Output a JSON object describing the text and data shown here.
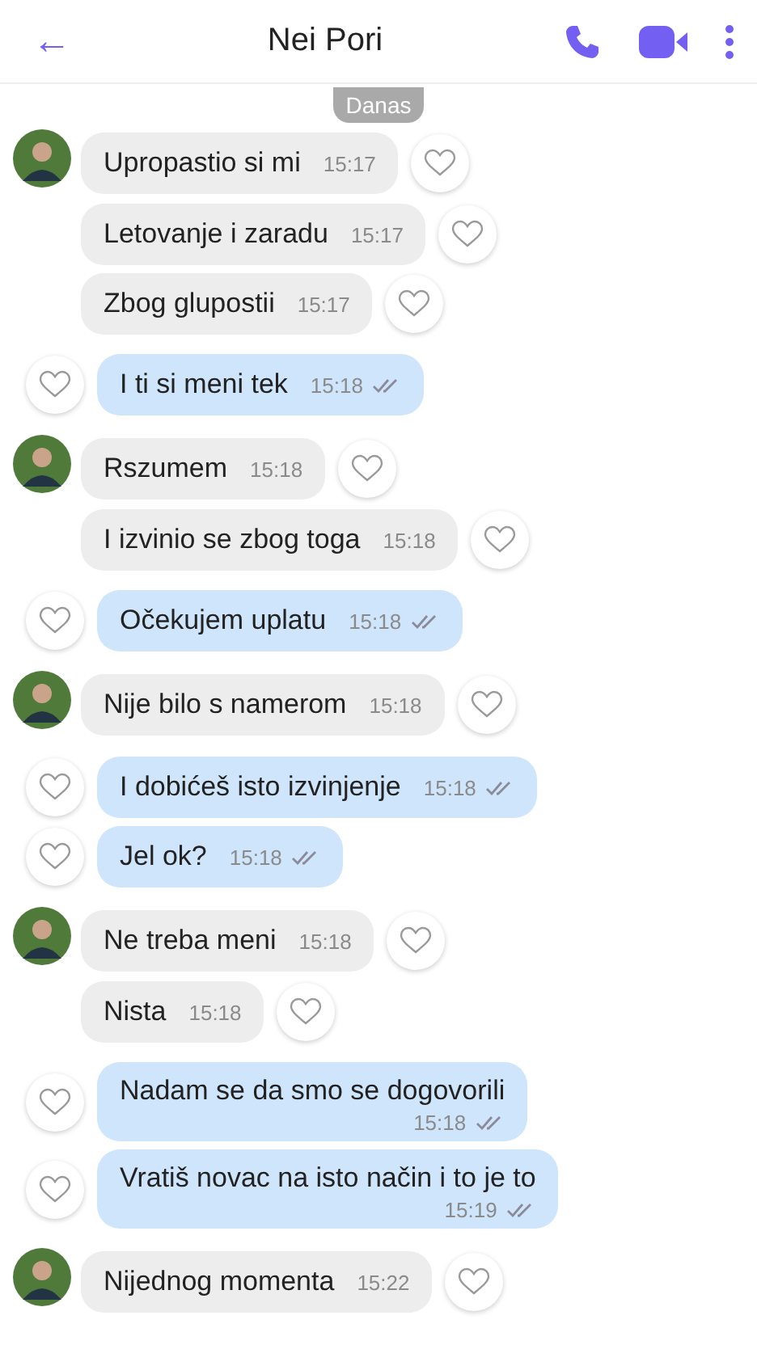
{
  "header": {
    "back": "←",
    "title": "Nei Pori"
  },
  "date_badge": "Danas",
  "messages": [
    {
      "kind": "incoming",
      "avatar": true,
      "text": "Upropastio si mi",
      "time": "15:17"
    },
    {
      "kind": "incoming",
      "avatar": false,
      "text": "Letovanje i zaradu",
      "time": "15:17"
    },
    {
      "kind": "incoming",
      "avatar": false,
      "text": "Zbog glupostii",
      "time": "15:17"
    },
    {
      "kind": "outgoing",
      "text": "I ti si meni tek",
      "time": "15:18"
    },
    {
      "kind": "incoming",
      "avatar": true,
      "text": "Rszumem",
      "time": "15:18"
    },
    {
      "kind": "incoming",
      "avatar": false,
      "text": "I izvinio se zbog toga",
      "time": "15:18"
    },
    {
      "kind": "outgoing",
      "text": "Očekujem uplatu",
      "time": "15:18"
    },
    {
      "kind": "incoming",
      "avatar": true,
      "text": "Nije bilo s namerom",
      "time": "15:18"
    },
    {
      "kind": "outgoing",
      "text": "I dobićeš isto izvinjenje",
      "time": "15:18"
    },
    {
      "kind": "outgoing",
      "text": "Jel ok?",
      "time": "15:18"
    },
    {
      "kind": "incoming",
      "avatar": true,
      "text": "Ne treba meni",
      "time": "15:18"
    },
    {
      "kind": "incoming",
      "avatar": false,
      "text": "Nista",
      "time": "15:18"
    },
    {
      "kind": "outgoing",
      "stacked": true,
      "text": "Nadam se da smo se dogovorili",
      "time": "15:18"
    },
    {
      "kind": "outgoing",
      "stacked": true,
      "text": "Vratiš novac na isto način i to je to",
      "time": "15:19"
    },
    {
      "kind": "incoming",
      "avatar": true,
      "text": "Nijednog momenta",
      "time": "15:22"
    }
  ]
}
